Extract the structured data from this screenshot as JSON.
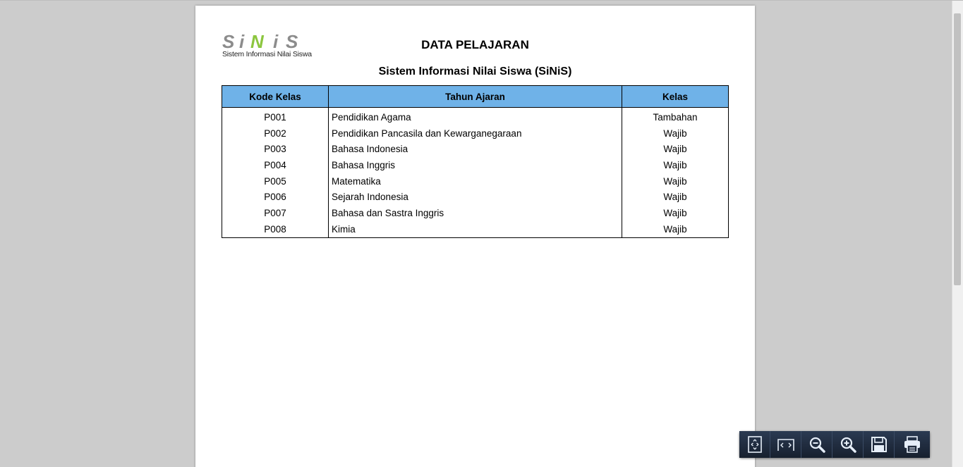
{
  "logo": {
    "mark_letters": [
      "S",
      "i",
      "N",
      "i",
      "S"
    ],
    "subtitle": "Sistem Informasi Nilai Siswa",
    "colors": {
      "gray": "#8c8c8c",
      "green": "#8cc63f"
    }
  },
  "report": {
    "title": "DATA PELAJARAN",
    "subtitle": "Sistem Informasi Nilai Siswa (SiNiS)"
  },
  "table": {
    "headers": [
      "Kode Kelas",
      "Tahun Ajaran",
      "Kelas"
    ],
    "header_color": "#6fb2e8",
    "rows": [
      [
        "P001",
        "Pendidikan Agama",
        "Tambahan"
      ],
      [
        "P002",
        "Pendidikan Pancasila dan Kewarganegaraan",
        "Wajib"
      ],
      [
        "P003",
        "Bahasa Indonesia",
        "Wajib"
      ],
      [
        "P004",
        "Bahasa Inggris",
        "Wajib"
      ],
      [
        "P005",
        "Matematika",
        "Wajib"
      ],
      [
        "P006",
        "Sejarah Indonesia",
        "Wajib"
      ],
      [
        "P007",
        "Bahasa dan Sastra Inggris",
        "Wajib"
      ],
      [
        "P008",
        "Kimia",
        "Wajib"
      ]
    ]
  },
  "toolbar": {
    "buttons": [
      "fit-page-icon",
      "fit-width-icon",
      "zoom-out-icon",
      "zoom-in-icon",
      "save-icon",
      "print-icon"
    ],
    "color": "#1f2a3c"
  }
}
